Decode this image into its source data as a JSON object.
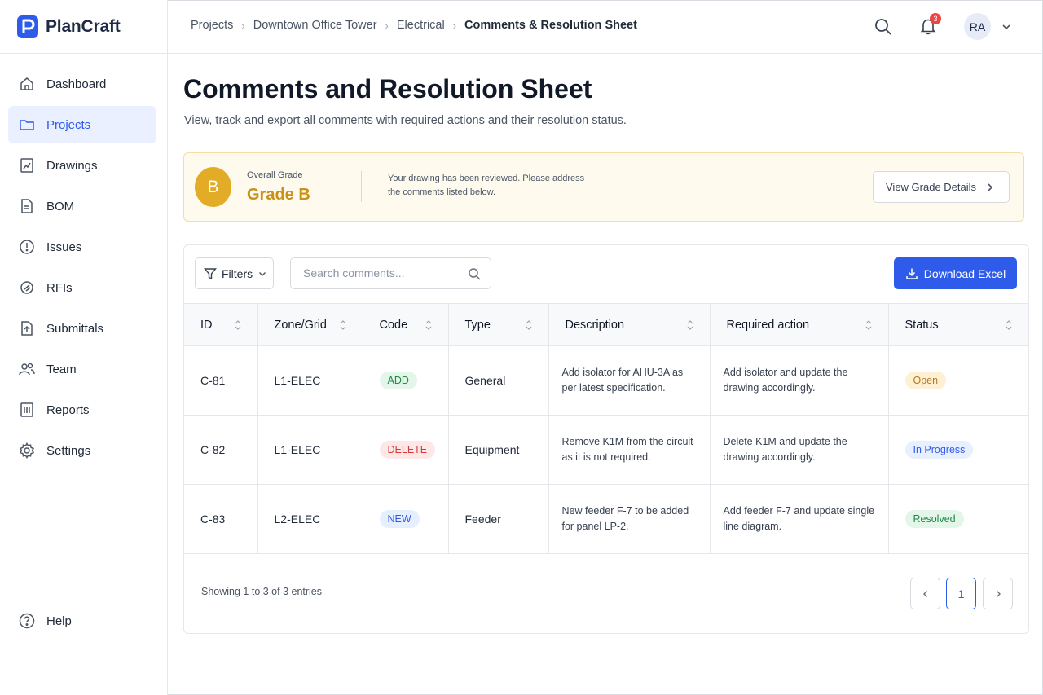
{
  "app": {
    "name": "PlanCraft"
  },
  "sidebar": {
    "items": [
      {
        "label": "Dashboard",
        "icon": "home-icon",
        "active": false
      },
      {
        "label": "Projects",
        "icon": "folder-icon",
        "active": true
      },
      {
        "label": "Drawings",
        "icon": "drawing-icon",
        "active": false
      },
      {
        "label": "BOM",
        "icon": "document-icon",
        "active": false
      },
      {
        "label": "Issues",
        "icon": "alert-circle-icon",
        "active": false
      },
      {
        "label": "RFIs",
        "icon": "rfi-icon",
        "active": false
      },
      {
        "label": "Submittals",
        "icon": "file-upload-icon",
        "active": false
      },
      {
        "label": "Team",
        "icon": "users-icon",
        "active": false
      },
      {
        "label": "Reports",
        "icon": "report-icon",
        "active": false
      },
      {
        "label": "Settings",
        "icon": "gear-icon",
        "active": false
      }
    ],
    "help_label": "Help"
  },
  "breadcrumb": {
    "items": [
      "Projects",
      "Downtown Office Tower",
      "Electrical"
    ],
    "current": "Comments & Resolution Sheet"
  },
  "topbar": {
    "notification_count": "3",
    "user_initials": "RA"
  },
  "page": {
    "title": "Comments and Resolution Sheet",
    "subtitle": "View, track and export all comments with required actions and their resolution status."
  },
  "grade": {
    "letter": "B",
    "label": "Overall Grade",
    "value": "Grade B",
    "message": "Your drawing has been reviewed. Please address the comments listed below.",
    "button_label": "View Grade Details",
    "accent_color": "#e2ac26"
  },
  "toolbar": {
    "filters_label": "Filters",
    "search_placeholder": "Search comments...",
    "download_label": "Download Excel",
    "accent_color": "#2f5bea"
  },
  "table": {
    "columns": [
      "ID",
      "Zone/Grid",
      "Code",
      "Type",
      "Description",
      "Required action",
      "Status"
    ],
    "rows": [
      {
        "id": "C-81",
        "zone": "L1-ELEC",
        "code": "ADD",
        "type": "General",
        "description": "Add isolator for AHU-3A as per latest specification.",
        "action": "Add isolator and update the drawing accordingly.",
        "status": "Open"
      },
      {
        "id": "C-82",
        "zone": "L1-ELEC",
        "code": "DELETE",
        "type": "Equipment",
        "description": "Remove K1M from the circuit as it is not required.",
        "action": "Delete K1M and update the drawing accordingly.",
        "status": "In Progress"
      },
      {
        "id": "C-83",
        "zone": "L2-ELEC",
        "code": "NEW",
        "type": "Feeder",
        "description": "New feeder F-7 to be added for panel LP-2.",
        "action": "Add feeder F-7 and update single line diagram.",
        "status": "Resolved"
      }
    ]
  },
  "pagination": {
    "summary": "Showing 1 to 3 of 3 entries",
    "current_page": "1"
  }
}
